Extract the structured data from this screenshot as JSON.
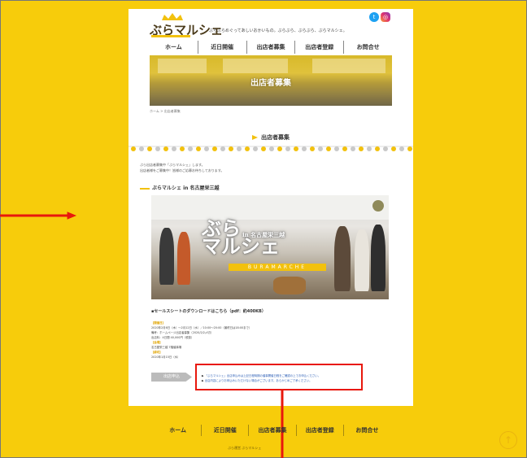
{
  "header": {
    "logo_text": "ぶらマルシェ",
    "tagline": "ぶらぶらめぐってあしいおかいもの。ぶらぶら、ぶらぶら、ぶらマルシェ。",
    "twitter_icon": "twitter-icon",
    "instagram_icon": "instagram-icon"
  },
  "nav": {
    "items": [
      {
        "label": "ホーム"
      },
      {
        "label": "近日開催"
      },
      {
        "label": "出店者募集"
      },
      {
        "label": "出店者登録"
      },
      {
        "label": "お問合せ"
      }
    ]
  },
  "hero": {
    "title": "出店者募集"
  },
  "breadcrumb": "ホーム > 出店者募集",
  "section": {
    "title": "出店者募集"
  },
  "intro": {
    "line1": "ぶら出店者募集中「ぶらマルシェ」します。",
    "line2": "出店者様をご募集中！皆様のご応募お待ちしております。"
  },
  "market": {
    "title": "ぶらマルシェ in 名古屋栄三越",
    "photo_title_1": "ぶら",
    "photo_title_2": "マルシェ",
    "photo_sub": "in 名古屋栄三越",
    "roman": "BURAMARCHE"
  },
  "download": "▪セールスシートのダウンロードはこちら（pdf：約400KB）",
  "details": {
    "schedule_head": "【開催日】",
    "schedule_1": "2020年2月6日（木）～2月12日（水）／10:00～20:00（最終日は18:00まで）",
    "schedule_2": "備考：ホームページ出店者募集（2020/2/2〆切）",
    "schedule_3": "出店料：4日間 40,000円（税抜）",
    "place_head": "【会場】",
    "place_1": "名古屋栄三越 7階催事場",
    "deadline_head": "【締切】",
    "deadline_1": "2020年1月15日（水）"
  },
  "apply": {
    "label": "出店申込"
  },
  "notes": {
    "line1": "「ぶらマルシェ」出店申込みは上記日程時期の催事開催日程をご確認の上でお申込ください。",
    "line2": "出店内容によりお申込みいただけない場合がございます。あらかじめご了承ください。"
  },
  "footer": {
    "items": [
      {
        "label": "ホーム"
      },
      {
        "label": "近日開催"
      },
      {
        "label": "出店者募集"
      },
      {
        "label": "出店者登録"
      },
      {
        "label": "お問合せ"
      }
    ],
    "copyright": "ぶら運営 ぶらマルシェ"
  },
  "page_top_icon": "arrow-up-circle-icon",
  "colors": {
    "background": "#f7cc0b",
    "accent": "#f2c10e",
    "annotation": "#e8180c",
    "link": "#2d5fb6"
  }
}
